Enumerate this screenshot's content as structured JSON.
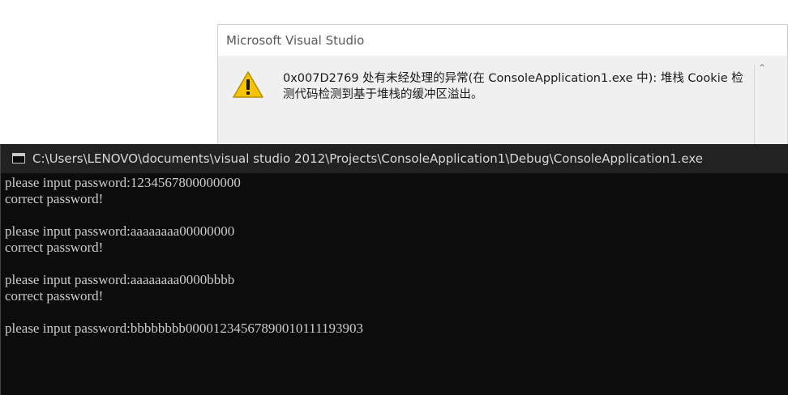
{
  "dialog": {
    "title": "Microsoft Visual Studio",
    "icon": "warning-icon",
    "message": "0x007D2769 处有未经处理的异常(在 ConsoleApplication1.exe 中): 堆栈 Cookie 检测代码检测到基于堆栈的缓冲区溢出。",
    "scroll_up_glyph": "⌃"
  },
  "console": {
    "icon": "console-window-icon",
    "title": "C:\\Users\\LENOVO\\documents\\visual studio 2012\\Projects\\ConsoleApplication1\\Debug\\ConsoleApplication1.exe",
    "lines": [
      "please input password:1234567800000000",
      "correct password!",
      "",
      "please input password:aaaaaaaa00000000",
      "correct password!",
      "",
      "please input password:aaaaaaaa0000bbbb",
      "correct password!",
      "",
      "please input password:bbbbbbbb00001234567890010111193903"
    ]
  },
  "colors": {
    "console_bg": "#0c0c0c",
    "console_text": "#cccccc",
    "console_titlebar": "#222222",
    "dialog_body": "#f0f0f0",
    "warning_yellow": "#f5c400"
  }
}
